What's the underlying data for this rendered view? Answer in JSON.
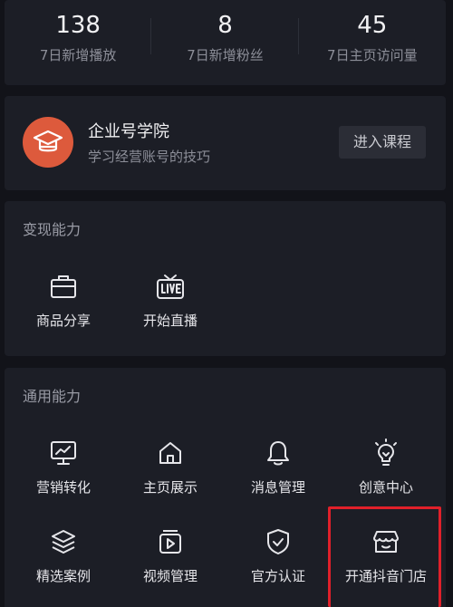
{
  "stats": [
    {
      "value": "138",
      "label": "7日新增播放"
    },
    {
      "value": "8",
      "label": "7日新增粉丝"
    },
    {
      "value": "45",
      "label": "7日主页访问量"
    }
  ],
  "academy": {
    "title": "企业号学院",
    "subtitle": "学习经营账号的技巧",
    "button": "进入课程",
    "icon": "graduation-cap-icon",
    "icon_bg": "#dd5a3c"
  },
  "monetize": {
    "title": "变现能力",
    "items": [
      {
        "label": "商品分享",
        "icon": "briefcase-icon"
      },
      {
        "label": "开始直播",
        "icon": "live-tv-icon"
      }
    ]
  },
  "general": {
    "title": "通用能力",
    "items": [
      {
        "label": "营销转化",
        "icon": "monitor-chart-icon"
      },
      {
        "label": "主页展示",
        "icon": "home-icon"
      },
      {
        "label": "消息管理",
        "icon": "bell-icon"
      },
      {
        "label": "创意中心",
        "icon": "lightbulb-icon"
      },
      {
        "label": "精选案例",
        "icon": "layers-icon"
      },
      {
        "label": "视频管理",
        "icon": "video-play-icon"
      },
      {
        "label": "官方认证",
        "icon": "shield-check-icon"
      },
      {
        "label": "开通抖音门店",
        "icon": "store-icon"
      }
    ]
  },
  "colors": {
    "background": "#121319",
    "card": "#1c1e26",
    "highlight": "#e0202a"
  }
}
